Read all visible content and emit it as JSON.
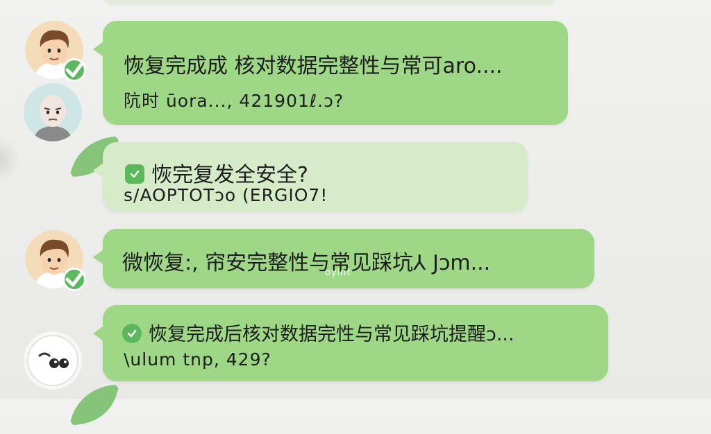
{
  "colors": {
    "bubble": "#9ed886",
    "bubble_faded": "#d6ecc9",
    "check": "#5cb85c",
    "background": "#eeeeec"
  },
  "messages": [
    {
      "avatar": "man-brown-hair-avatar",
      "line1": "恢复完成成 核对数据完整性与常可aro....",
      "line2": "阬时 ūora..., 421901ℓ.ↄ?"
    },
    {
      "avatar": "bald-man-avatar"
    },
    {
      "line1": "恢完复发全安全?",
      "line2": "s/AOPTOTↄo (ERGIO7!"
    },
    {
      "avatar": "man-brown-hair-avatar",
      "line1": "微恢复:, 帘安完整性与常见踩坑⅄ Jɔm...",
      "sub": "oyint"
    },
    {
      "avatar": "white-bubble-avatar",
      "line1": "恢复完成后核对数据完性与常见踩坑提醒ↄ...",
      "line2": "\\ulum tnp, 429?"
    }
  ]
}
